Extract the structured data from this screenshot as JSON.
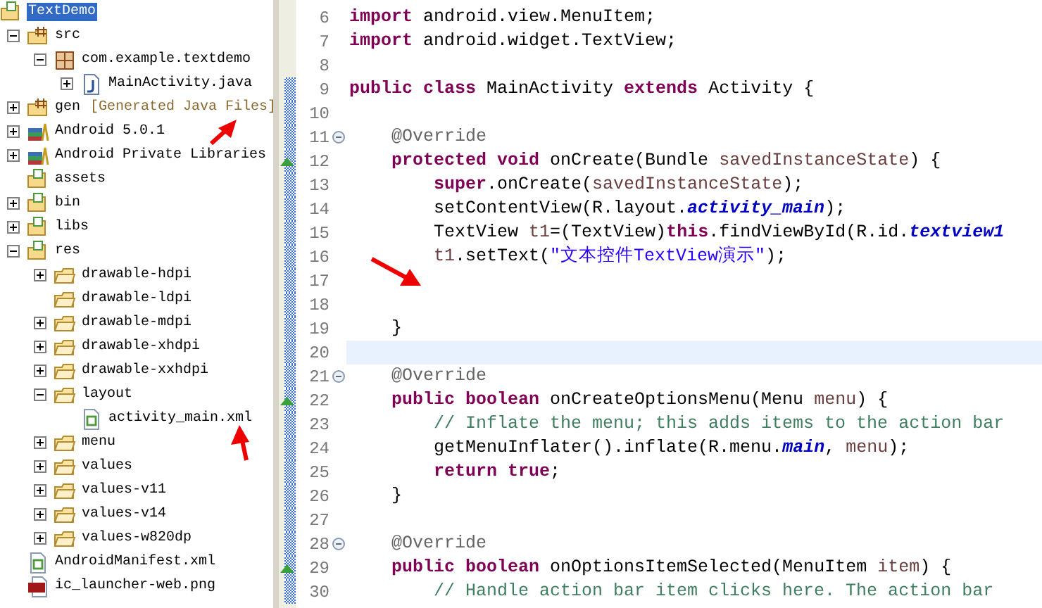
{
  "package_explorer": {
    "tree": [
      {
        "label": "TextDemo",
        "kind": "project",
        "selected": true,
        "children": [
          {
            "label": "src",
            "kind": "source-folder",
            "expanded": true,
            "selected": false,
            "children": [
              {
                "label": "com.example.textdemo",
                "kind": "package",
                "expanded": true,
                "selected": false,
                "children": [
                  {
                    "label": "MainActivity.java",
                    "kind": "java-file",
                    "expanded": false,
                    "selected": false
                  }
                ]
              }
            ]
          },
          {
            "label": "gen",
            "decoration": "[Generated Java Files]",
            "kind": "source-folder",
            "expanded": false,
            "selected": false
          },
          {
            "label": "Android 5.0.1",
            "kind": "library",
            "expanded": false,
            "selected": false
          },
          {
            "label": "Android Private Libraries",
            "kind": "library",
            "expanded": false,
            "selected": false
          },
          {
            "label": "assets",
            "kind": "project",
            "selected": false
          },
          {
            "label": "bin",
            "kind": "project",
            "expanded": false,
            "selected": false
          },
          {
            "label": "libs",
            "kind": "project",
            "expanded": false,
            "selected": false
          },
          {
            "label": "res",
            "kind": "project",
            "expanded": true,
            "selected": false,
            "children": [
              {
                "label": "drawable-hdpi",
                "kind": "folder",
                "expanded": false,
                "selected": false
              },
              {
                "label": "drawable-ldpi",
                "kind": "folder",
                "selected": false
              },
              {
                "label": "drawable-mdpi",
                "kind": "folder",
                "expanded": false,
                "selected": false
              },
              {
                "label": "drawable-xhdpi",
                "kind": "folder",
                "expanded": false,
                "selected": false
              },
              {
                "label": "drawable-xxhdpi",
                "kind": "folder",
                "expanded": false,
                "selected": false
              },
              {
                "label": "layout",
                "kind": "folder",
                "expanded": true,
                "selected": false,
                "children": [
                  {
                    "label": "activity_main.xml",
                    "kind": "xml-file",
                    "selected": false
                  }
                ]
              },
              {
                "label": "menu",
                "kind": "folder",
                "expanded": false,
                "selected": false
              },
              {
                "label": "values",
                "kind": "folder",
                "expanded": false,
                "selected": false
              },
              {
                "label": "values-v11",
                "kind": "folder",
                "expanded": false,
                "selected": false
              },
              {
                "label": "values-v14",
                "kind": "folder",
                "expanded": false,
                "selected": false
              },
              {
                "label": "values-w820dp",
                "kind": "folder",
                "expanded": false,
                "selected": false
              }
            ]
          },
          {
            "label": "AndroidManifest.xml",
            "kind": "xml-file",
            "selected": false
          },
          {
            "label": "ic_launcher-web.png",
            "kind": "png-file",
            "selected": false
          }
        ]
      }
    ]
  },
  "editor": {
    "lines": [
      {
        "number": "6",
        "kind": "plain",
        "changed": false,
        "tokens": [
          {
            "kind": "keyword",
            "t": "import"
          },
          {
            "kind": "plain",
            "t": " android.view.MenuItem;"
          }
        ]
      },
      {
        "number": "7",
        "kind": "plain",
        "changed": false,
        "tokens": [
          {
            "kind": "keyword",
            "t": "import"
          },
          {
            "kind": "plain",
            "t": " android.widget.TextView;"
          }
        ]
      },
      {
        "number": "8",
        "kind": "plain",
        "changed": false
      },
      {
        "number": "9",
        "kind": "plain",
        "changed": true,
        "tokens": [
          {
            "kind": "keyword",
            "t": "public class"
          },
          {
            "kind": "plain",
            "t": " MainActivity "
          },
          {
            "kind": "keyword",
            "t": "extends"
          },
          {
            "kind": "plain",
            "t": " Activity {"
          }
        ]
      },
      {
        "number": "10",
        "kind": "plain",
        "changed": true
      },
      {
        "number": "11",
        "kind": "fold",
        "changed": true,
        "tokens": [
          {
            "kind": "annotation",
            "t": "    @Override"
          }
        ]
      },
      {
        "number": "12",
        "kind": "override",
        "changed": true,
        "tokens": [
          {
            "kind": "keyword",
            "t": "    protected void"
          },
          {
            "kind": "plain",
            "t": " onCreate(Bundle "
          },
          {
            "kind": "variable",
            "t": "savedInstanceState"
          },
          {
            "kind": "plain",
            "t": ") {"
          }
        ]
      },
      {
        "number": "13",
        "kind": "plain",
        "changed": true,
        "tokens": [
          {
            "kind": "keyword",
            "t": "        super"
          },
          {
            "kind": "plain",
            "t": ".onCreate("
          },
          {
            "kind": "variable",
            "t": "savedInstanceState"
          },
          {
            "kind": "plain",
            "t": ");"
          }
        ]
      },
      {
        "number": "14",
        "kind": "plain",
        "changed": true,
        "tokens": [
          {
            "kind": "plain",
            "t": "        setContentView(R.layout."
          },
          {
            "kind": "field",
            "t": "activity_main"
          },
          {
            "kind": "plain",
            "t": ");"
          }
        ]
      },
      {
        "number": "15",
        "kind": "plain",
        "changed": true,
        "tokens": [
          {
            "kind": "plain",
            "t": "        TextView "
          },
          {
            "kind": "variable",
            "t": "t1"
          },
          {
            "kind": "plain",
            "t": "=(TextView)"
          },
          {
            "kind": "keyword",
            "t": "this"
          },
          {
            "kind": "plain",
            "t": ".findViewById(R.id."
          },
          {
            "kind": "field",
            "t": "textview1"
          }
        ]
      },
      {
        "number": "16",
        "kind": "plain",
        "changed": true,
        "tokens": [
          {
            "kind": "variable",
            "t": "        t1"
          },
          {
            "kind": "plain",
            "t": ".setText("
          },
          {
            "kind": "string",
            "t": "\"文本控件TextView演示\""
          },
          {
            "kind": "plain",
            "t": ");"
          }
        ]
      },
      {
        "number": "17",
        "kind": "plain",
        "changed": true
      },
      {
        "number": "18",
        "kind": "plain",
        "changed": true
      },
      {
        "number": "19",
        "kind": "plain",
        "changed": true,
        "tokens": [
          {
            "kind": "plain",
            "t": "    }"
          }
        ]
      },
      {
        "number": "20",
        "kind": "plain",
        "changed": true,
        "current": true
      },
      {
        "number": "21",
        "kind": "fold",
        "changed": true,
        "tokens": [
          {
            "kind": "annotation",
            "t": "    @Override"
          }
        ]
      },
      {
        "number": "22",
        "kind": "override",
        "changed": true,
        "tokens": [
          {
            "kind": "keyword",
            "t": "    public boolean"
          },
          {
            "kind": "plain",
            "t": " onCreateOptionsMenu(Menu "
          },
          {
            "kind": "variable",
            "t": "menu"
          },
          {
            "kind": "plain",
            "t": ") {"
          }
        ]
      },
      {
        "number": "23",
        "kind": "plain",
        "changed": true,
        "tokens": [
          {
            "kind": "comment",
            "t": "        // Inflate the menu; this adds items to the action bar"
          }
        ]
      },
      {
        "number": "24",
        "kind": "plain",
        "changed": true,
        "tokens": [
          {
            "kind": "plain",
            "t": "        getMenuInflater().inflate(R.menu."
          },
          {
            "kind": "field",
            "t": "main"
          },
          {
            "kind": "plain",
            "t": ", "
          },
          {
            "kind": "variable",
            "t": "menu"
          },
          {
            "kind": "plain",
            "t": ");"
          }
        ]
      },
      {
        "number": "25",
        "kind": "plain",
        "changed": true,
        "tokens": [
          {
            "kind": "keyword",
            "t": "        return true"
          },
          {
            "kind": "plain",
            "t": ";"
          }
        ]
      },
      {
        "number": "26",
        "kind": "plain",
        "changed": true,
        "tokens": [
          {
            "kind": "plain",
            "t": "    }"
          }
        ]
      },
      {
        "number": "27",
        "kind": "plain",
        "changed": true
      },
      {
        "number": "28",
        "kind": "fold",
        "changed": true,
        "tokens": [
          {
            "kind": "annotation",
            "t": "    @Override"
          }
        ]
      },
      {
        "number": "29",
        "kind": "override",
        "changed": true,
        "tokens": [
          {
            "kind": "keyword",
            "t": "    public boolean"
          },
          {
            "kind": "plain",
            "t": " onOptionsItemSelected(MenuItem "
          },
          {
            "kind": "variable",
            "t": "item"
          },
          {
            "kind": "plain",
            "t": ") {"
          }
        ]
      },
      {
        "number": "30",
        "kind": "plain",
        "changed": true,
        "tokens": [
          {
            "kind": "comment",
            "t": "        // Handle action bar item clicks here. The action bar"
          }
        ]
      }
    ]
  }
}
